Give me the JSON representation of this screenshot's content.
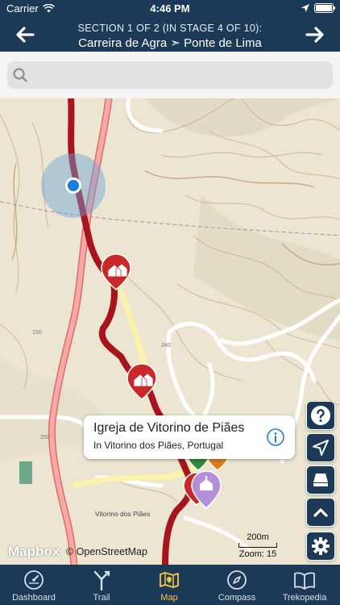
{
  "status": {
    "carrier": "Carrier",
    "time": "4:46 PM"
  },
  "header": {
    "subtitle": "SECTION 1 OF 2 (IN STAGE 4 OF 10):",
    "title": "Carreira de Agra ➣ Ponte de Lima"
  },
  "search": {
    "placeholder": "",
    "value": ""
  },
  "map": {
    "attribution_logo": "Mapbox",
    "attribution": "© OpenStreetMap",
    "scale_label": "200m",
    "zoom_label": "Zoom: 15",
    "place_label": "Vitorino dos Piães",
    "road_numbers": [
      "150",
      "240",
      "250"
    ],
    "popup": {
      "title": "Igreja de Vitorino de Piães",
      "subtitle": "In Vitorino dos Piães, Portugal"
    }
  },
  "tabs": [
    {
      "label": "Dashboard",
      "icon": "dashboard-icon"
    },
    {
      "label": "Trail",
      "icon": "trail-icon"
    },
    {
      "label": "Map",
      "icon": "map-icon",
      "active": true
    },
    {
      "label": "Compass",
      "icon": "compass-icon"
    },
    {
      "label": "Trekopedia",
      "icon": "book-icon"
    }
  ],
  "colors": {
    "brand": "#1c3a57",
    "active_tab": "#f5c842",
    "trail": "#a8141c",
    "location": "#1a7de0"
  }
}
